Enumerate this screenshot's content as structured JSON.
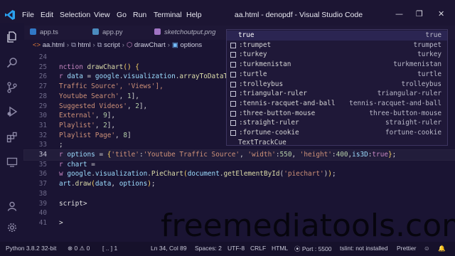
{
  "menu": [
    "File",
    "Edit",
    "Selection",
    "View",
    "Go",
    "Run",
    "Terminal",
    "Help"
  ],
  "window_title": "aa.html - denopdf - Visual Studio Code",
  "window_controls": {
    "minimize": "—",
    "maximize": "❐",
    "close": "✕"
  },
  "tabs": [
    {
      "label": "app.ts",
      "icon": "typescript-file-icon",
      "color": "#3178c6"
    },
    {
      "label": "app.py",
      "icon": "python-file-icon",
      "color": "#4b8bbe"
    },
    {
      "label": "sketchoutput.png",
      "icon": "image-file-icon",
      "color": "#a074c4"
    }
  ],
  "breadcrumb": [
    "aa.html",
    "html",
    "script",
    "drawChart",
    "options"
  ],
  "editor": {
    "lines": [
      {
        "n": "24",
        "text": ""
      },
      {
        "n": "25",
        "text": "nction drawChart() {"
      },
      {
        "n": "26",
        "text": "r data = google.visualization.arrayToDataTa"
      },
      {
        "n": "27",
        "text": "Traffic Source', 'Views'],"
      },
      {
        "n": "28",
        "text": "Youtube Search', 1],"
      },
      {
        "n": "29",
        "text": "Suggested Videos', 2],"
      },
      {
        "n": "30",
        "text": "External', 9],"
      },
      {
        "n": "31",
        "text": "Playlist', 2],"
      },
      {
        "n": "32",
        "text": "Playlist Page', 8]"
      },
      {
        "n": "33",
        "text": ";"
      },
      {
        "n": "34",
        "text": "r options = {'title':'Youtube Traffic Source', 'width':550, 'height':400,is3D:true};"
      },
      {
        "n": "35",
        "text": "r chart ="
      },
      {
        "n": "36",
        "text": "w google.visualization.PieChart(document.getElementById('piechart'));"
      },
      {
        "n": "37",
        "text": "art.draw(data, options);"
      },
      {
        "n": "38",
        "text": ""
      },
      {
        "n": "39",
        "text": "script>"
      },
      {
        "n": "40",
        "text": ""
      },
      {
        "n": "41",
        "text": ">"
      }
    ]
  },
  "suggestions": [
    {
      "label": "true",
      "detail": "true",
      "selected": true
    },
    {
      "label": ":trumpet",
      "detail": "trumpet"
    },
    {
      "label": ":turkey",
      "detail": "turkey"
    },
    {
      "label": ":turkmenistan",
      "detail": "turkmenistan"
    },
    {
      "label": ":turtle",
      "detail": "turtle"
    },
    {
      "label": ":trolleybus",
      "detail": "trolleybus"
    },
    {
      "label": ":triangular-ruler",
      "detail": "triangular-ruler"
    },
    {
      "label": ":tennis-racquet-and-ball",
      "detail": "tennis-racquet-and-ball"
    },
    {
      "label": ":three-button-mouse",
      "detail": "three-button-mouse"
    },
    {
      "label": ":straight-ruler",
      "detail": "straight-ruler"
    },
    {
      "label": ":fortune-cookie",
      "detail": "fortune-cookie"
    },
    {
      "label": "TextTrackCue",
      "detail": ""
    }
  ],
  "statusbar": {
    "python": "Python 3.8.2 32-bit",
    "errors": "0",
    "warnings": "0",
    "sync": "[ .. ] 1",
    "position": "Ln 34, Col 89",
    "spaces": "Spaces: 2",
    "encoding": "UTF-8",
    "eol": "CRLF",
    "language": "HTML",
    "port": "Port : 5500",
    "lint": "tslint: not installed",
    "formatter": "Prettier"
  },
  "watermark": "freemediatools.com",
  "colors": {
    "background": "#1a1433",
    "accent": "#007acc",
    "suggest_selected": "#2b2552"
  }
}
